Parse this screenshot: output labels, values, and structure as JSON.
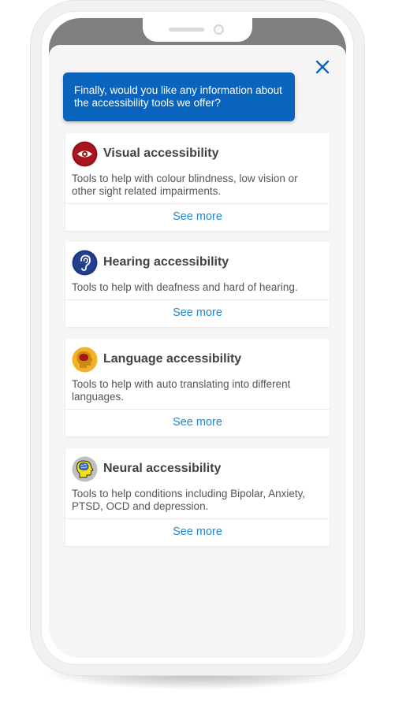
{
  "chat": {
    "close_icon": "close-icon",
    "prompt": "Finally, would you like any information about the accessibility tools we offer?",
    "accent_color": "#0a63bd",
    "link_color": "#1e88d2"
  },
  "cards": [
    {
      "icon": "eye-icon",
      "icon_color": "#a8171f",
      "title": "Visual accessibility",
      "description": "Tools to help with colour blindness, low vision or other sight related impairments.",
      "link": "See more"
    },
    {
      "icon": "ear-icon",
      "icon_color": "#243f8f",
      "title": "Hearing accessibility",
      "description": "Tools to help with deafness and hard of hearing.",
      "link": "See more"
    },
    {
      "icon": "head-speech-icon",
      "icon_color": "#f2b126",
      "title": "Language accessibility",
      "description": "Tools to help with auto translating into different languages.",
      "link": "See more"
    },
    {
      "icon": "brain-head-icon",
      "icon_color": "#bfbfbf",
      "title": "Neural accessibility",
      "description": "Tools to help conditions including Bipolar, Anxiety, PTSD, OCD and depression.",
      "link": "See more"
    }
  ]
}
